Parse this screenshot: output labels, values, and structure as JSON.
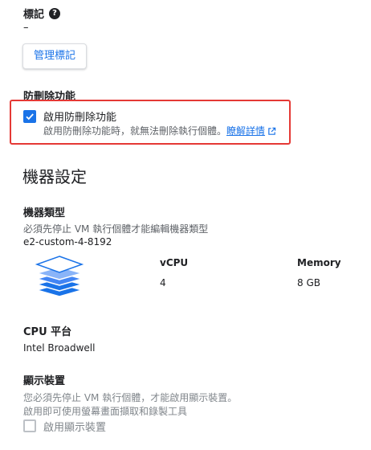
{
  "labels": {
    "title": "標記",
    "value": "–",
    "manage_button": "管理標記"
  },
  "deletion": {
    "title": "防刪除功能",
    "checkbox_label": "啟用防刪除功能",
    "checked": true,
    "helper": "啟用防刪除功能時，就無法刪除執行個體。",
    "learn_more": "瞭解詳情"
  },
  "machine": {
    "heading": "機器設定",
    "type_title": "機器類型",
    "type_note": "必須先停止 VM 執行個體才能編輯機器類型",
    "type_value": "e2-custom-4-8192",
    "vcpu_label": "vCPU",
    "vcpu_value": "4",
    "memory_label": "Memory",
    "memory_value": "8 GB",
    "cpu_platform_title": "CPU 平台",
    "cpu_platform_value": "Intel Broadwell"
  },
  "display": {
    "title": "顯示裝置",
    "note_line1": "您必須先停止 VM 執行個體，才能啟用顯示裝置。",
    "note_line2": "啟用即可使用螢幕畫面擷取和錄製工具",
    "checkbox_label": "啟用顯示裝置",
    "checked": false
  },
  "colors": {
    "accent": "#1a73e8",
    "highlight_border": "#e53935"
  }
}
